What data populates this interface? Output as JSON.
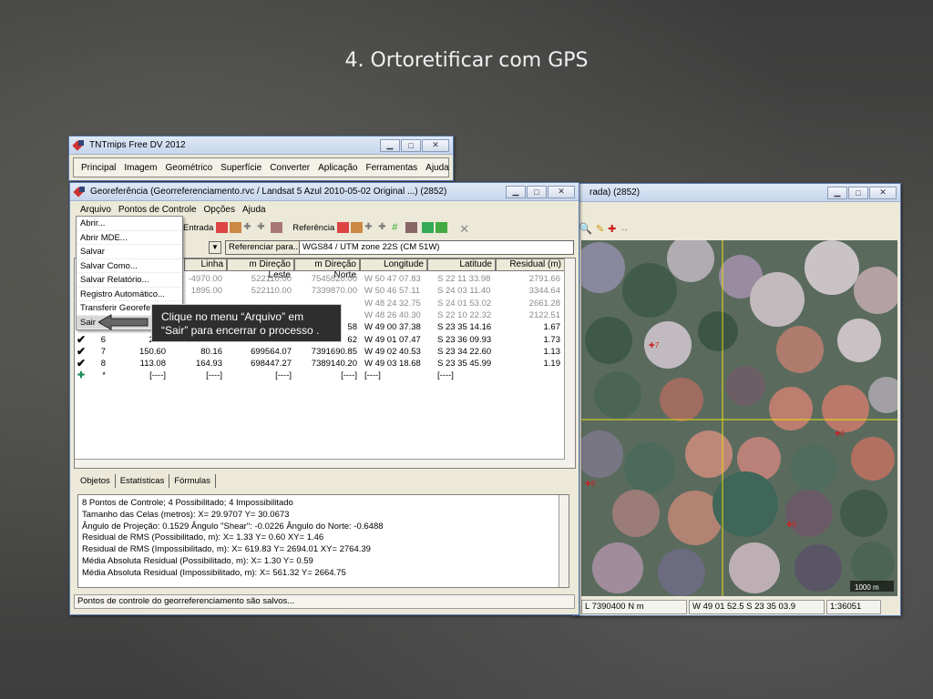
{
  "slide": {
    "title": "4. Ortoretificar com GPS"
  },
  "main_window": {
    "title": "TNTmips Free DV 2012",
    "menu": [
      "Principal",
      "Imagem",
      "Geométrico",
      "Superfície",
      "Converter",
      "Aplicação",
      "Ferramentas",
      "Ajuda"
    ]
  },
  "geo_window": {
    "title": "Georeferência (Georreferenciamento.rvc / Landsat 5 Azul 2010-05-02 Original ...) (2852)",
    "menu": [
      "Arquivo",
      "Pontos de Controle",
      "Opções",
      "Ajuda"
    ],
    "entrada_label": "Entrada",
    "referencia_label": "Referência",
    "referenciar_button": "Referenciar para...",
    "projection_value": "WGS84 / UTM zone 22S (CM 51W)",
    "columns": [
      "Linha",
      "m Direção Leste",
      "m Direção Norte",
      "Longitude",
      "Latitude",
      "Residual (m)"
    ],
    "rows": [
      {
        "id": "",
        "coluna": "",
        "linha": "-4970.00",
        "leste": "522110.00",
        "norte": "7545820.00",
        "lon": "W 50 47 07.83",
        "lat": "S 22 11 33.98",
        "res": "2791.66",
        "dim": true
      },
      {
        "id": "",
        "coluna": "",
        "linha": "1895.00",
        "leste": "522110.00",
        "norte": "7339870.00",
        "lon": "W 50 46 57.11",
        "lat": "S 24 03 11.40",
        "res": "3344.64",
        "dim": true
      },
      {
        "id": "",
        "coluna": "",
        "linha": "",
        "leste": "",
        "norte": "",
        "lon": "W 48 24 32.75",
        "lat": "S 24 01 53.02",
        "res": "2661.28",
        "dim": true
      },
      {
        "id": "",
        "coluna": "",
        "linha": "",
        "leste": "",
        "norte": "",
        "lon": "W 48 26 40.30",
        "lat": "S 22 10 22.32",
        "res": "2122.51",
        "dim": true
      },
      {
        "id": "",
        "coluna": "",
        "linha": "",
        "leste": "",
        "norte": "58",
        "lon": "W 49 00 37.38",
        "lat": "S 23 35 14.16",
        "res": "1.67",
        "dim": false
      },
      {
        "id": "6",
        "coluna": "236.",
        "linha": "",
        "leste": "",
        "norte": "62",
        "lon": "W 49 01 07.47",
        "lat": "S 23 36 09.93",
        "res": "1.73",
        "dim": false
      },
      {
        "id": "7",
        "coluna": "150.60",
        "linha": "80.16",
        "leste": "699564.07",
        "norte": "7391690.85",
        "lon": "W 49 02 40.53",
        "lat": "S 23 34 22.60",
        "res": "1.13",
        "dim": false
      },
      {
        "id": "8",
        "coluna": "113.08",
        "linha": "164.93",
        "leste": "698447.27",
        "norte": "7389140.20",
        "lon": "W 49 03 18.68",
        "lat": "S 23 35 45.99",
        "res": "1.19",
        "dim": false
      },
      {
        "id": "*",
        "coluna": "[----]",
        "linha": "[----]",
        "leste": "[----]",
        "norte": "[----]",
        "lon": "[----]",
        "lat": "[----]",
        "res": "",
        "dim": false
      }
    ],
    "tabs": [
      "Objetos",
      "Estatísticas",
      "Fórmulas"
    ],
    "info_lines": [
      "8 Pontos de Controle;  4 Possibilitado;  4 Impossibilitado",
      "Tamanho das Celas (metros):  X= 29.9707  Y= 30.0673",
      "Ângulo de Projeção: 0.1529  Ângulo \"Shear\": -0.0226  Ângulo do Norte: -0.6488",
      "Residual de RMS (Possibilitado, m):  X= 1.33  Y= 0.60  XY= 1.46",
      "Residual de RMS (Impossibilitado, m):  X= 619.83  Y= 2694.01  XY= 2764.39",
      "Média Absoluta Residual (Possibilitado, m):  X= 1.30  Y= 0.59",
      "Média Absoluta Residual (Impossibilitado, m):  X= 561.32  Y= 2664.75"
    ],
    "status": "Pontos de controle do georreferenciamento são salvos..."
  },
  "file_menu": {
    "items": [
      "Abrir...",
      "Abrir MDE...",
      "Salvar",
      "Salvar Como...",
      "Salvar Relatório...",
      "Registro Automático...",
      "Transferir Georefe",
      "Sair"
    ],
    "selected": "Sair"
  },
  "tooltip": {
    "line1": "Clique no menu “Arquivo” em",
    "line2": "“Sair” para encerrar o processo ."
  },
  "image_window": {
    "title": "rada) (2852)",
    "scale_text": "1000 m",
    "status_coord": "L 7390400 N m",
    "status_latlon": "W 49 01 52.5  S 23 35 03.9",
    "status_scale": "1:36051"
  }
}
